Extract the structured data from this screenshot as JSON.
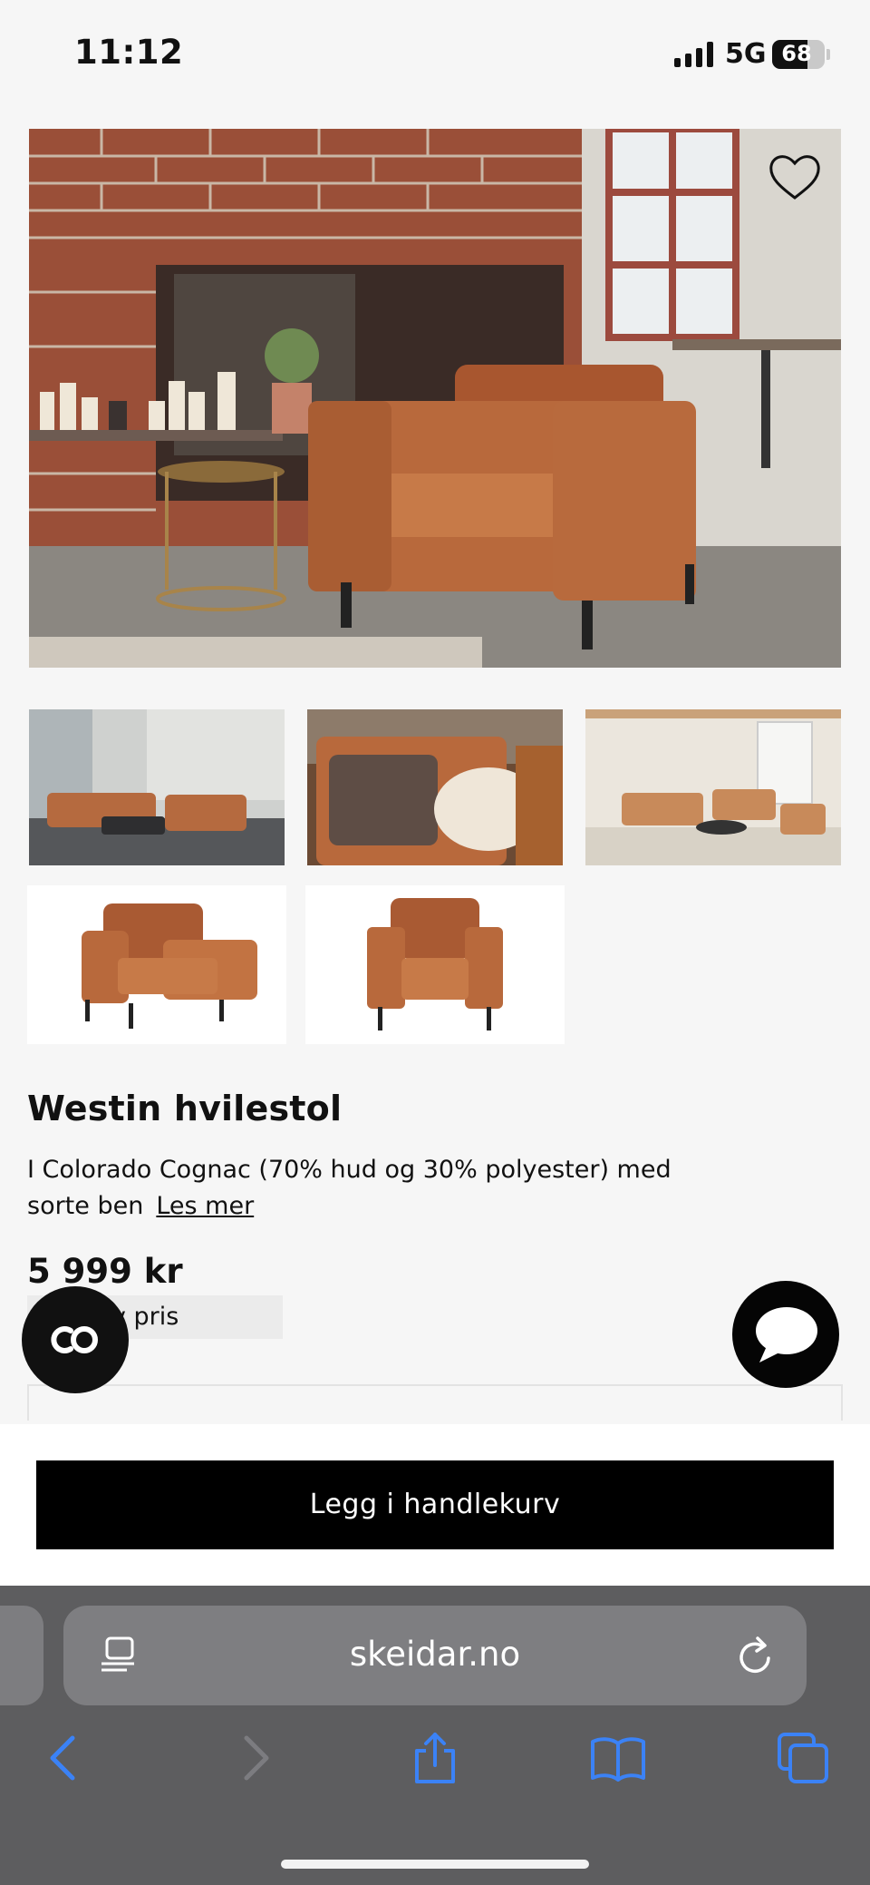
{
  "status_bar": {
    "time": "11:12",
    "network": "5G",
    "battery": "68",
    "battery_level": 0.68
  },
  "product": {
    "title": "Westin hvilestol",
    "description": "I Colorado Cognac (70% hud og 30% polyester) med sorte ben",
    "read_more": "Les mer",
    "price": "5 999 kr",
    "badge": "Tid lav pris"
  },
  "actions": {
    "add_to_cart": "Legg i handlekurv"
  },
  "browser": {
    "url": "skeidar.no"
  },
  "colors": {
    "cognac": "#b8693c",
    "button": "#000000",
    "safari_bar": "#5d5d5f",
    "ios_blue": "#3b82f6"
  },
  "icons": [
    "heart-icon",
    "co-icon",
    "chat-bubble-icon",
    "reader-icon",
    "reload-icon",
    "back-icon",
    "forward-icon",
    "share-icon",
    "bookmarks-icon",
    "tabs-icon"
  ]
}
